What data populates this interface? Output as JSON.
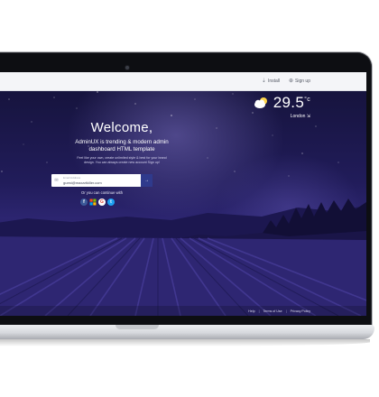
{
  "topbar": {
    "install_label": "Install",
    "signup_label": "Sign up"
  },
  "weather": {
    "temperature": "29.5",
    "unit": "°c",
    "city": "London",
    "icon": "cloud-icon"
  },
  "hero": {
    "welcome": "Welcome,",
    "tagline_line1": "AdminUX is trending & modern admin",
    "tagline_line2": "dashboard HTML template",
    "desc_line1": "Feel like your own, create unlimited style & best for your brand",
    "desc_line2": "design. You can always create new account Sign up!"
  },
  "login": {
    "label": "Email Address",
    "value": "guest@maxartkiller.com",
    "submit_icon": "arrow-right-icon"
  },
  "social": {
    "continue_label": "Or you can continue with",
    "providers": [
      "facebook",
      "windows",
      "google",
      "twitter"
    ]
  },
  "footer": {
    "help": "Help",
    "terms": "Terms of Use",
    "privacy": "Privacy Policy"
  },
  "colors": {
    "sky_top": "#141238",
    "sky_mid": "#2c2570",
    "field": "#2a2266",
    "accent": "#2f3a8c"
  }
}
